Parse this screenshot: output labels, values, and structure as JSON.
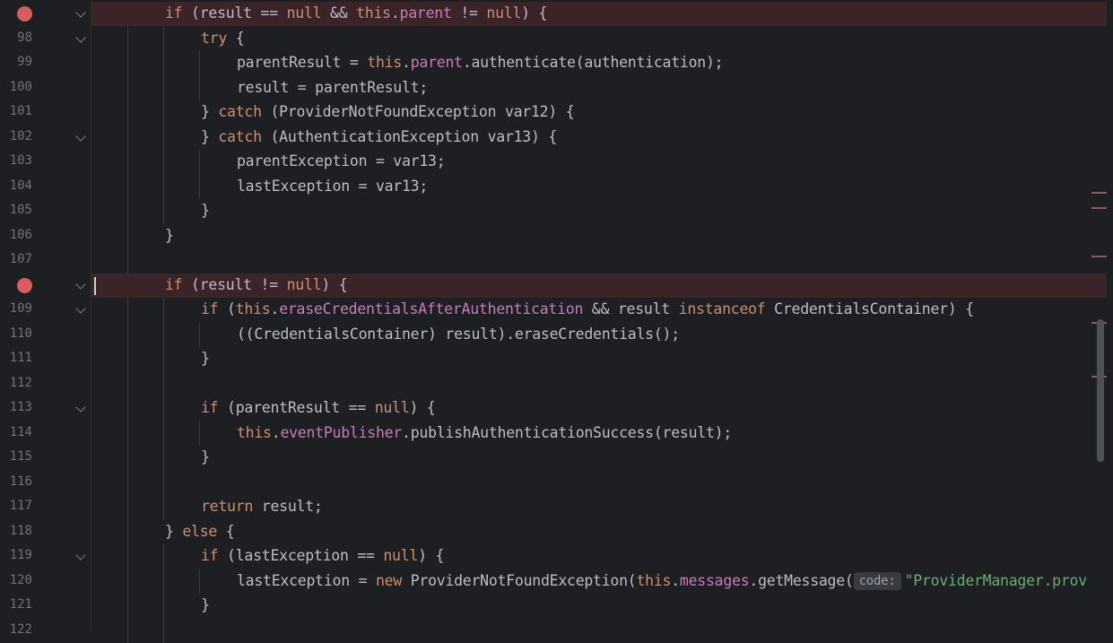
{
  "editor": {
    "colors": {
      "background": "#1e1f22",
      "keyword": "#cf8e6d",
      "field": "#c77dbb",
      "string": "#6aab73",
      "breakpoint": "#db5c5c",
      "breakpoint_line": "#3a2427"
    },
    "lines": [
      {
        "num": "",
        "bp": true,
        "fold": true,
        "indent": 2,
        "tokens": [
          [
            "kw",
            "if"
          ],
          [
            "t",
            " (result == "
          ],
          [
            "kw",
            "null"
          ],
          [
            "t",
            " && "
          ],
          [
            "kw",
            "this"
          ],
          [
            "t",
            "."
          ],
          [
            "fld",
            "parent"
          ],
          [
            "t",
            " != "
          ],
          [
            "kw",
            "null"
          ],
          [
            "t",
            ") {"
          ]
        ]
      },
      {
        "num": "98",
        "bp": false,
        "fold": true,
        "indent": 3,
        "tokens": [
          [
            "kw",
            "try"
          ],
          [
            "t",
            " {"
          ]
        ]
      },
      {
        "num": "99",
        "bp": false,
        "fold": false,
        "indent": 4,
        "tokens": [
          [
            "t",
            "parentResult = "
          ],
          [
            "kw",
            "this"
          ],
          [
            "t",
            "."
          ],
          [
            "fld",
            "parent"
          ],
          [
            "t",
            ".authenticate(authentication);"
          ]
        ]
      },
      {
        "num": "100",
        "bp": false,
        "fold": false,
        "indent": 4,
        "tokens": [
          [
            "t",
            "result = parentResult;"
          ]
        ]
      },
      {
        "num": "101",
        "bp": false,
        "fold": false,
        "indent": 3,
        "tokens": [
          [
            "t",
            "} "
          ],
          [
            "kw",
            "catch"
          ],
          [
            "t",
            " (ProviderNotFoundException var12) {"
          ]
        ]
      },
      {
        "num": "102",
        "bp": false,
        "fold": true,
        "indent": 3,
        "tokens": [
          [
            "t",
            "} "
          ],
          [
            "kw",
            "catch"
          ],
          [
            "t",
            " (AuthenticationException var13) {"
          ]
        ]
      },
      {
        "num": "103",
        "bp": false,
        "fold": false,
        "indent": 4,
        "tokens": [
          [
            "t",
            "parentException = var13;"
          ]
        ]
      },
      {
        "num": "104",
        "bp": false,
        "fold": false,
        "indent": 4,
        "tokens": [
          [
            "t",
            "lastException = var13;"
          ]
        ]
      },
      {
        "num": "105",
        "bp": false,
        "fold": false,
        "indent": 3,
        "tokens": [
          [
            "t",
            "}"
          ]
        ]
      },
      {
        "num": "106",
        "bp": false,
        "fold": false,
        "indent": 2,
        "tokens": [
          [
            "t",
            "}"
          ]
        ]
      },
      {
        "num": "107",
        "bp": false,
        "fold": false,
        "indent": 0,
        "tokens": []
      },
      {
        "num": "",
        "bp": true,
        "fold": true,
        "indent": 2,
        "tokens": [
          [
            "kw",
            "if"
          ],
          [
            "t",
            " (result != "
          ],
          [
            "kw",
            "null"
          ],
          [
            "t",
            ") {"
          ]
        ]
      },
      {
        "num": "109",
        "bp": false,
        "fold": true,
        "indent": 3,
        "tokens": [
          [
            "kw",
            "if"
          ],
          [
            "t",
            " ("
          ],
          [
            "kw",
            "this"
          ],
          [
            "t",
            "."
          ],
          [
            "fld",
            "eraseCredentialsAfterAuthentication"
          ],
          [
            "t",
            " && result "
          ],
          [
            "kw",
            "instanceof"
          ],
          [
            "t",
            " CredentialsContainer) {"
          ]
        ]
      },
      {
        "num": "110",
        "bp": false,
        "fold": false,
        "indent": 4,
        "tokens": [
          [
            "t",
            "((CredentialsContainer) result).eraseCredentials();"
          ]
        ]
      },
      {
        "num": "111",
        "bp": false,
        "fold": false,
        "indent": 3,
        "tokens": [
          [
            "t",
            "}"
          ]
        ]
      },
      {
        "num": "112",
        "bp": false,
        "fold": false,
        "indent": 0,
        "tokens": []
      },
      {
        "num": "113",
        "bp": false,
        "fold": true,
        "indent": 3,
        "tokens": [
          [
            "kw",
            "if"
          ],
          [
            "t",
            " (parentResult == "
          ],
          [
            "kw",
            "null"
          ],
          [
            "t",
            ") {"
          ]
        ]
      },
      {
        "num": "114",
        "bp": false,
        "fold": false,
        "indent": 4,
        "tokens": [
          [
            "kw",
            "this"
          ],
          [
            "t",
            "."
          ],
          [
            "fld",
            "eventPublisher"
          ],
          [
            "t",
            ".publishAuthenticationSuccess(result);"
          ]
        ]
      },
      {
        "num": "115",
        "bp": false,
        "fold": false,
        "indent": 3,
        "tokens": [
          [
            "t",
            "}"
          ]
        ]
      },
      {
        "num": "116",
        "bp": false,
        "fold": false,
        "indent": 0,
        "tokens": []
      },
      {
        "num": "117",
        "bp": false,
        "fold": false,
        "indent": 3,
        "tokens": [
          [
            "kw",
            "return"
          ],
          [
            "t",
            " result;"
          ]
        ]
      },
      {
        "num": "118",
        "bp": false,
        "fold": false,
        "indent": 2,
        "tokens": [
          [
            "t",
            "} "
          ],
          [
            "kw",
            "else"
          ],
          [
            "t",
            " {"
          ]
        ]
      },
      {
        "num": "119",
        "bp": false,
        "fold": true,
        "indent": 3,
        "tokens": [
          [
            "kw",
            "if"
          ],
          [
            "t",
            " (lastException == "
          ],
          [
            "kw",
            "null"
          ],
          [
            "t",
            ") {"
          ]
        ]
      },
      {
        "num": "120",
        "bp": false,
        "fold": false,
        "indent": 4,
        "tokens": [
          [
            "t",
            "lastException = "
          ],
          [
            "kw",
            "new"
          ],
          [
            "t",
            " ProviderNotFoundException("
          ],
          [
            "kw",
            "this"
          ],
          [
            "t",
            "."
          ],
          [
            "fld",
            "messages"
          ],
          [
            "t",
            ".getMessage("
          ],
          [
            "hint",
            "code:"
          ],
          [
            "str",
            "\"ProviderManager.prov"
          ]
        ]
      },
      {
        "num": "121",
        "bp": false,
        "fold": false,
        "indent": 3,
        "tokens": [
          [
            "t",
            "}"
          ]
        ]
      },
      {
        "num": "122",
        "bp": false,
        "fold": false,
        "indent": 0,
        "tokens": []
      }
    ]
  }
}
